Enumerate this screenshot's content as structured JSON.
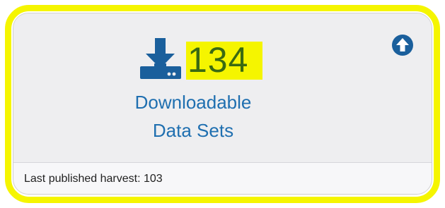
{
  "card": {
    "count": "134",
    "label_line1": "Downloadable",
    "label_line2": "Data Sets",
    "footer_text": "Last published harvest: 103"
  },
  "icons": {
    "download": "download-icon",
    "scroll_up": "arrow-up-circle-icon"
  },
  "colors": {
    "highlight": "#f5f500",
    "accent_blue": "#1f6fb0",
    "icon_blue": "#1a5f9c",
    "count_text": "#3a6a12"
  }
}
